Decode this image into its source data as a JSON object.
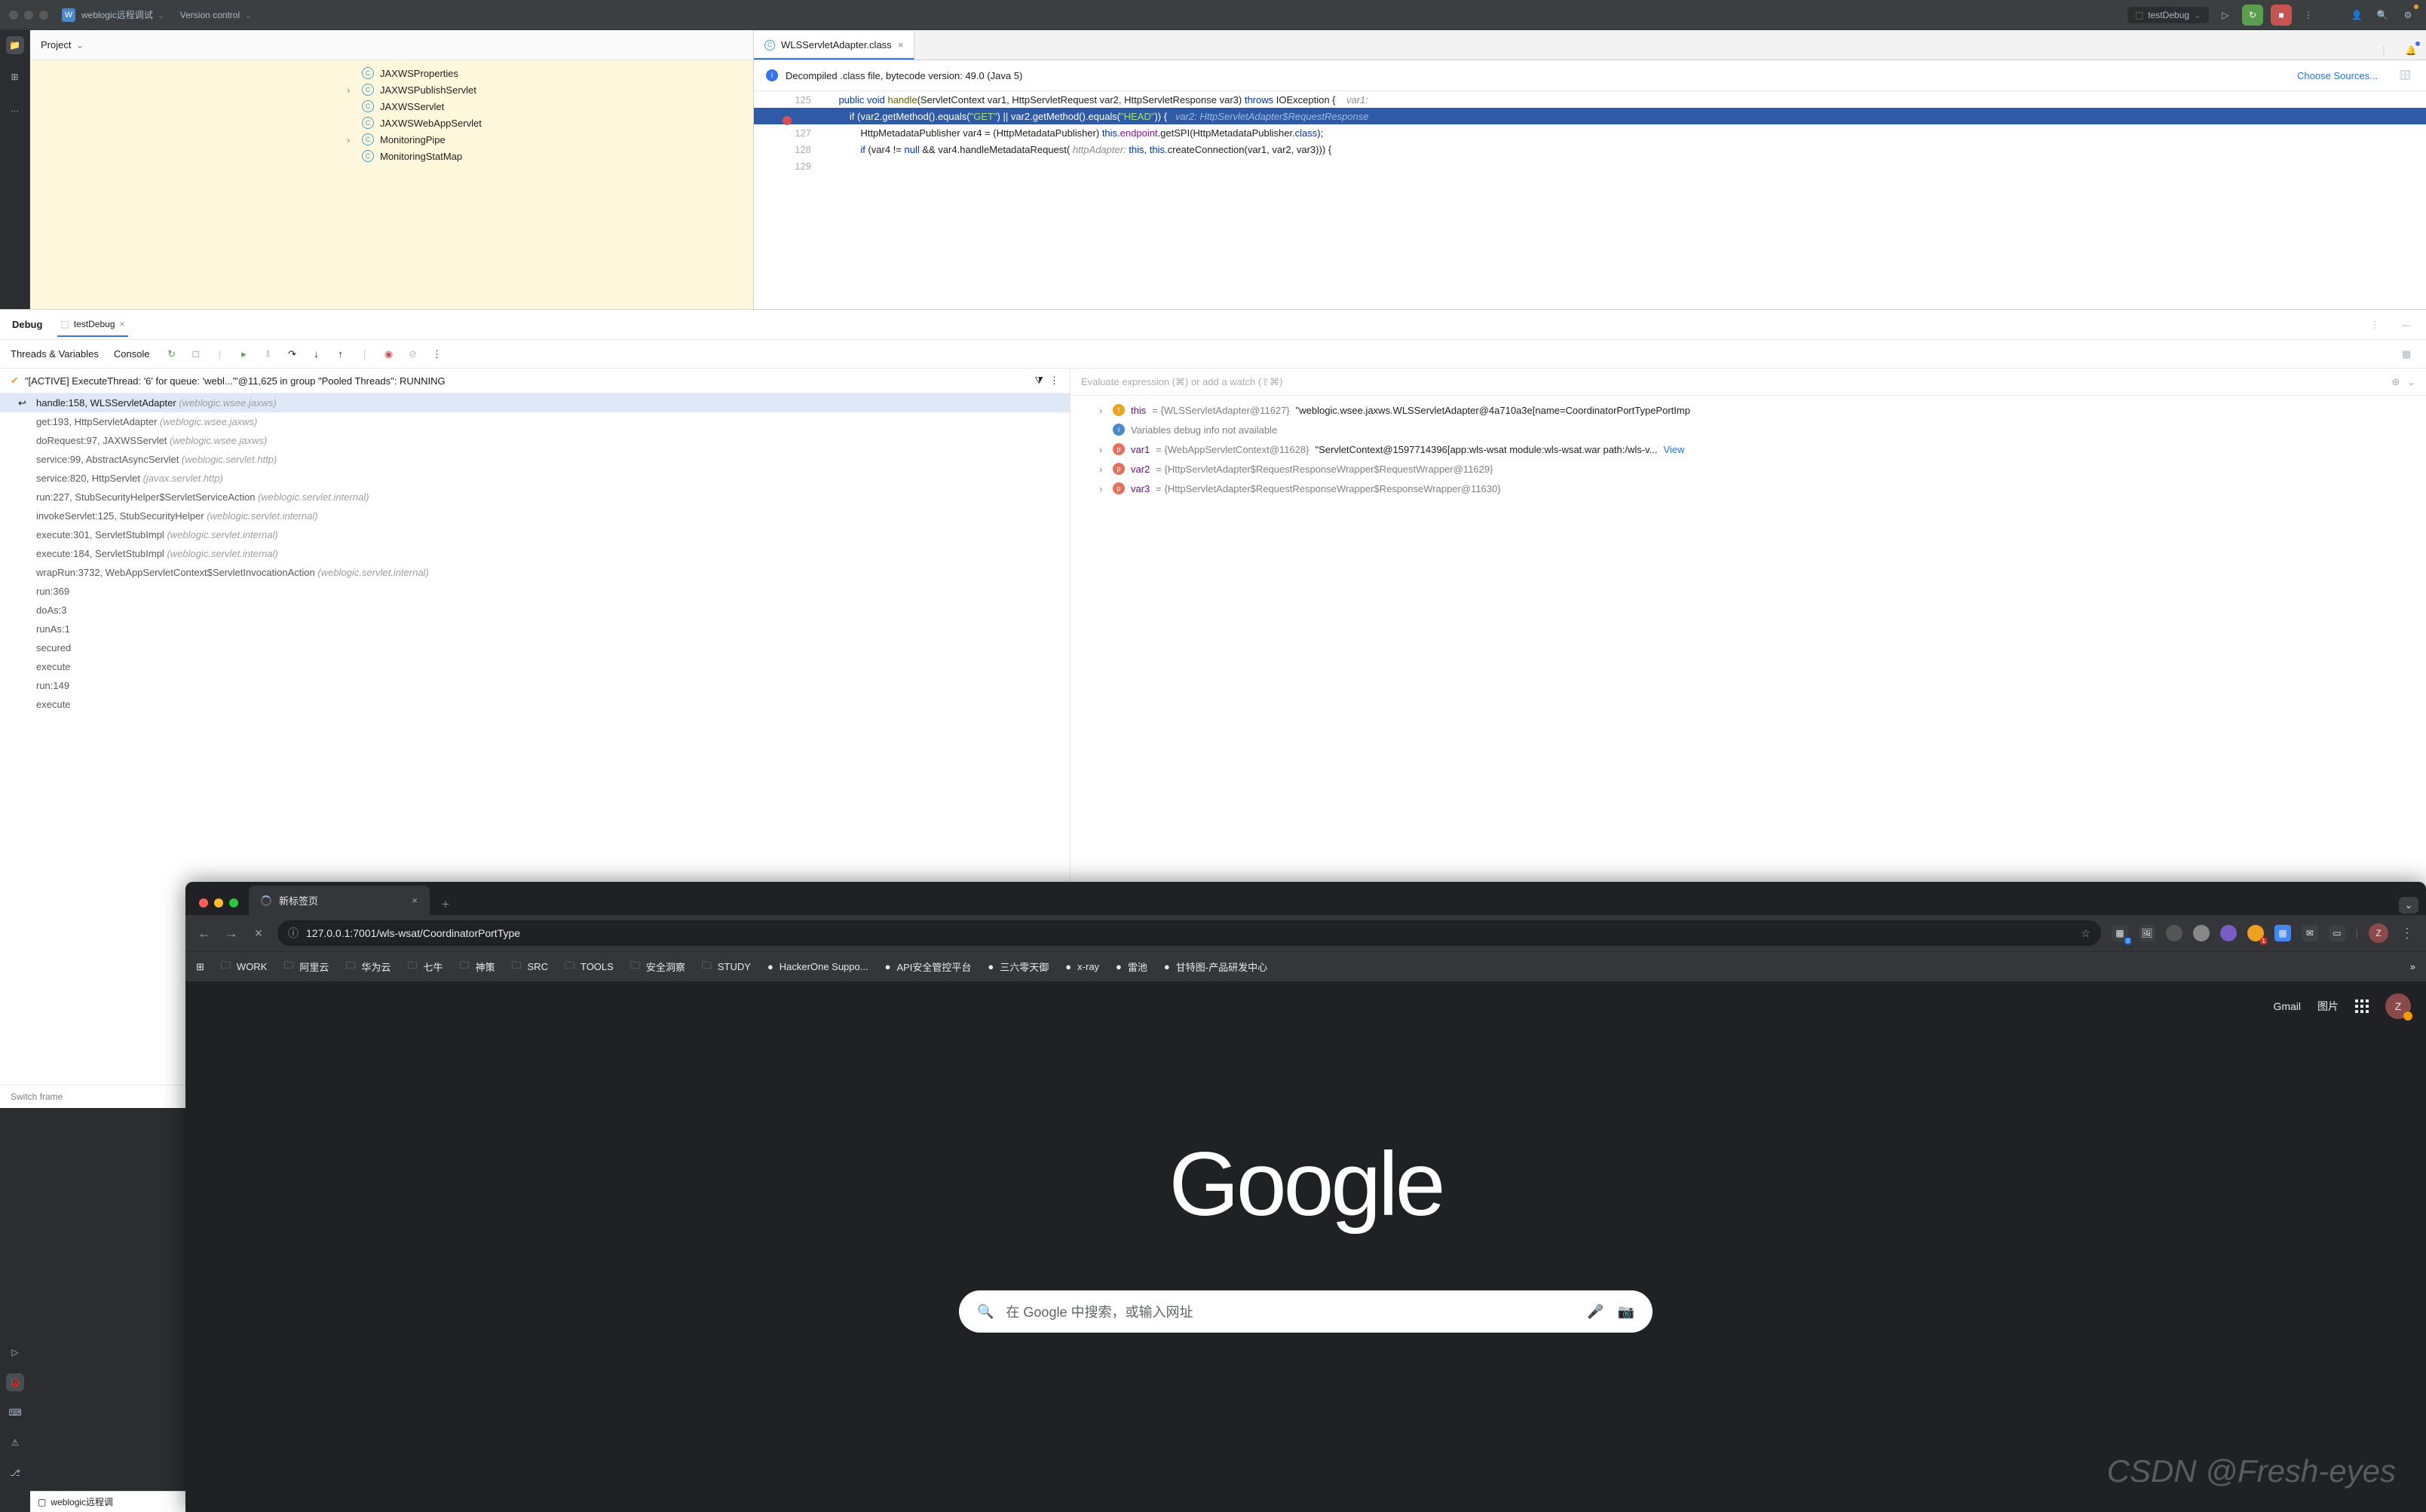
{
  "ide": {
    "project_name": "weblogic远程调试",
    "project_badge": "W",
    "version_control": "Version control",
    "run_config": "testDebug",
    "project_panel_title": "Project",
    "tree_items": [
      {
        "name": "JAXWSProperties",
        "chev": ""
      },
      {
        "name": "JAXWSPublishServlet",
        "chev": "›"
      },
      {
        "name": "JAXWSServlet",
        "chev": ""
      },
      {
        "name": "JAXWSWebAppServlet",
        "chev": ""
      },
      {
        "name": "MonitoringPipe",
        "chev": "›"
      },
      {
        "name": "MonitoringStatMap",
        "chev": ""
      }
    ],
    "editor_tab": "WLSServletAdapter.class",
    "notice_text": "Decompiled .class file, bytecode version: 49.0 (Java 5)",
    "choose_sources": "Choose Sources...",
    "code_lines": [
      {
        "num": "125",
        "html": "    <span class='kw'>public</span> <span class='kw'>void</span> <span class='fn'>handle</span>(ServletContext var1, HttpServletRequest var2, HttpServletResponse var3) <span class='kw'>throws</span> IOException {    <span class='param-hint'>var1:</span>"
      },
      {
        "num": "",
        "hl": true,
        "bp": true,
        "html": "        <span style='color:#fff'>if (var2.getMethod().equals(</span><span style='color:#a5e075'>\"GET\"</span><span style='color:#fff'>) || var2.getMethod().equals(</span><span style='color:#a5e075'>\"HEAD\"</span><span style='color:#fff'>)) {</span>   <span style='color:#9bbce0;font-style:italic'>var2: HttpServletAdapter$RequestResponse</span>"
      },
      {
        "num": "127",
        "html": "            HttpMetadataPublisher var4 = (HttpMetadataPublisher) <span class='kw'>this</span>.<span class='field'>endpoint</span>.getSPI(HttpMetadataPublisher.<span class='kw'>class</span>);"
      },
      {
        "num": "128",
        "html": "            <span class='kw'>if</span> (var4 != <span class='kw'>null</span> && var4.handleMetadataRequest( <span class='param-hint'>httpAdapter:</span> <span class='kw'>this</span>, <span class='kw'>this</span>.createConnection(var1, var2, var3))) {"
      },
      {
        "num": "129",
        "html": ""
      }
    ]
  },
  "debug": {
    "tab_debug": "Debug",
    "tab_config": "testDebug",
    "toolbar_threads": "Threads & Variables",
    "toolbar_console": "Console",
    "thread_text": "\"[ACTIVE] ExecuteThread: '6' for queue: 'webl...'\"@11,625 in group \"Pooled Threads\": RUNNING",
    "frames": [
      {
        "m": "handle:158, WLSServletAdapter",
        "p": "(weblogic.wsee.jaxws)",
        "cur": true
      },
      {
        "m": "get:193, HttpServletAdapter",
        "p": "(weblogic.wsee.jaxws)"
      },
      {
        "m": "doRequest:97, JAXWSServlet",
        "p": "(weblogic.wsee.jaxws)"
      },
      {
        "m": "service:99, AbstractAsyncServlet",
        "p": "(weblogic.servlet.http)"
      },
      {
        "m": "service:820, HttpServlet",
        "p": "(javax.servlet.http)"
      },
      {
        "m": "run:227, StubSecurityHelper$ServletServiceAction",
        "p": "(weblogic.servlet.internal)"
      },
      {
        "m": "invokeServlet:125, StubSecurityHelper",
        "p": "(weblogic.servlet.internal)"
      },
      {
        "m": "execute:301, ServletStubImpl",
        "p": "(weblogic.servlet.internal)"
      },
      {
        "m": "execute:184, ServletStubImpl",
        "p": "(weblogic.servlet.internal)"
      },
      {
        "m": "wrapRun:3732, WebAppServletContext$ServletInvocationAction",
        "p": "(weblogic.servlet.internal)"
      },
      {
        "m": "run:369",
        "p": ""
      },
      {
        "m": "doAs:3",
        "p": ""
      },
      {
        "m": "runAs:1",
        "p": ""
      },
      {
        "m": "secured",
        "p": ""
      },
      {
        "m": "execute",
        "p": ""
      },
      {
        "m": "run:149",
        "p": ""
      },
      {
        "m": "execute",
        "p": ""
      }
    ],
    "switch_frame": "Switch frame",
    "eval_placeholder": "Evaluate expression (⌘) or add a watch (⇧⌘)",
    "vars": [
      {
        "arr": "›",
        "icon": "f",
        "name": "this",
        "eq": " = ",
        "gval": "{WLSServletAdapter@11627}",
        "str": " \"weblogic.wsee.jaxws.WLSServletAdapter@4a710a3e[name=CoordinatorPortTypePortImp"
      },
      {
        "arr": "",
        "icon": "i",
        "name": "",
        "eq": "",
        "gval": "Variables debug info not available",
        "str": ""
      },
      {
        "arr": "›",
        "icon": "p",
        "name": "var1",
        "eq": " = ",
        "gval": "{WebAppServletContext@11628}",
        "str": " \"ServletContext@1597714396[app:wls-wsat module:wls-wsat.war path:/wls-v...",
        "link": " View"
      },
      {
        "arr": "›",
        "icon": "p",
        "name": "var2",
        "eq": " = ",
        "gval": "{HttpServletAdapter$RequestResponseWrapper$RequestWrapper@11629}",
        "str": ""
      },
      {
        "arr": "›",
        "icon": "p",
        "name": "var3",
        "eq": " = ",
        "gval": "{HttpServletAdapter$RequestResponseWrapper$ResponseWrapper@11630}",
        "str": ""
      }
    ]
  },
  "statusbar": {
    "project": "weblogic远程调"
  },
  "browser": {
    "tab_title": "新标签页",
    "url": "127.0.0.1:7001/wls-wsat/CoordinatorPortType",
    "bookmarks": [
      {
        "icon": "folder",
        "label": "WORK"
      },
      {
        "icon": "folder",
        "label": "阿里云"
      },
      {
        "icon": "folder",
        "label": "华为云"
      },
      {
        "icon": "folder",
        "label": "七牛"
      },
      {
        "icon": "folder",
        "label": "神策"
      },
      {
        "icon": "folder",
        "label": "SRC"
      },
      {
        "icon": "folder",
        "label": "TOOLS"
      },
      {
        "icon": "folder",
        "label": "安全洞察"
      },
      {
        "icon": "folder",
        "label": "STUDY"
      },
      {
        "icon": "site",
        "label": "HackerOne Suppo..."
      },
      {
        "icon": "site",
        "label": "API安全管控平台"
      },
      {
        "icon": "site",
        "label": "三六零天御"
      },
      {
        "icon": "site",
        "label": "x-ray"
      },
      {
        "icon": "site",
        "label": "雷池"
      },
      {
        "icon": "site",
        "label": "甘特图-产品研发中心"
      }
    ],
    "gmail": "Gmail",
    "images": "图片",
    "search_placeholder": "在 Google 中搜索，或输入网址",
    "logo": "Google",
    "avatar": "Z"
  },
  "watermark": "CSDN @Fresh-eyes"
}
